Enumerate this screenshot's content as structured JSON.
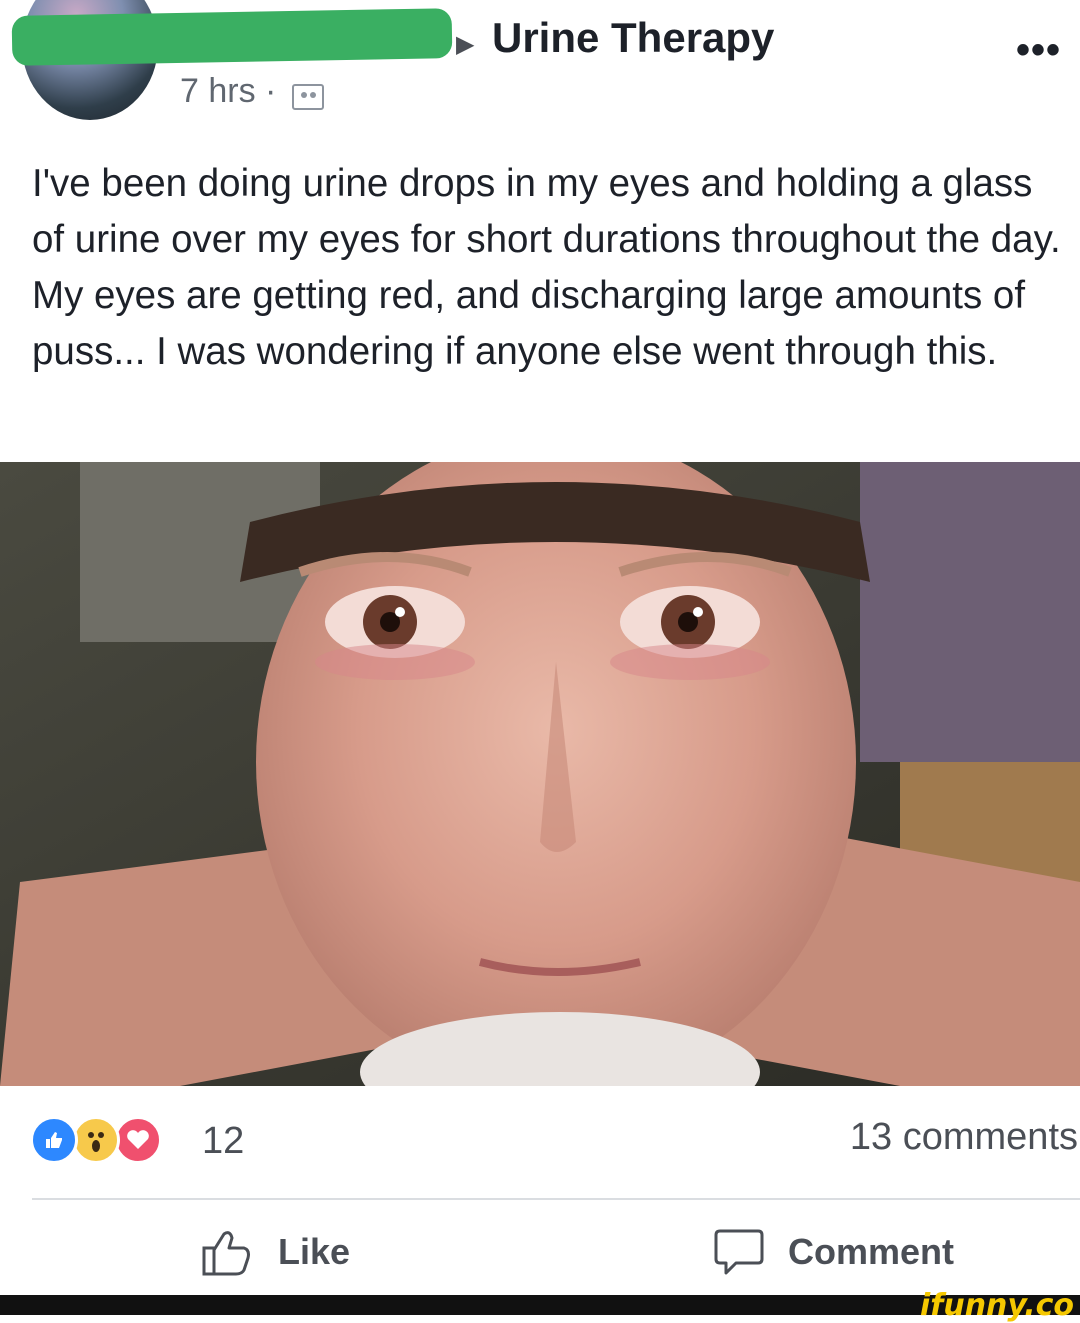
{
  "post": {
    "group_name": "Urine Therapy",
    "time": "7 hrs ·",
    "more_label": "•••",
    "text": "I've been doing urine drops in my eyes and holding a glass of urine over my eyes for short durations throughout the day. My eyes are getting red, and discharging large amounts of puss... I was wondering if anyone else went through this."
  },
  "stats": {
    "reaction_count": "12",
    "comments": "13 comments",
    "reactions": [
      "like-icon",
      "wow-icon",
      "love-icon"
    ]
  },
  "actions": {
    "like": "Like",
    "comment": "Comment"
  },
  "watermark": "ifunny.co",
  "colors": {
    "like_blue": "#2d88ff",
    "wow_yellow": "#f7c94b",
    "love_red": "#f0506e",
    "redaction_green": "#3aaf62"
  }
}
